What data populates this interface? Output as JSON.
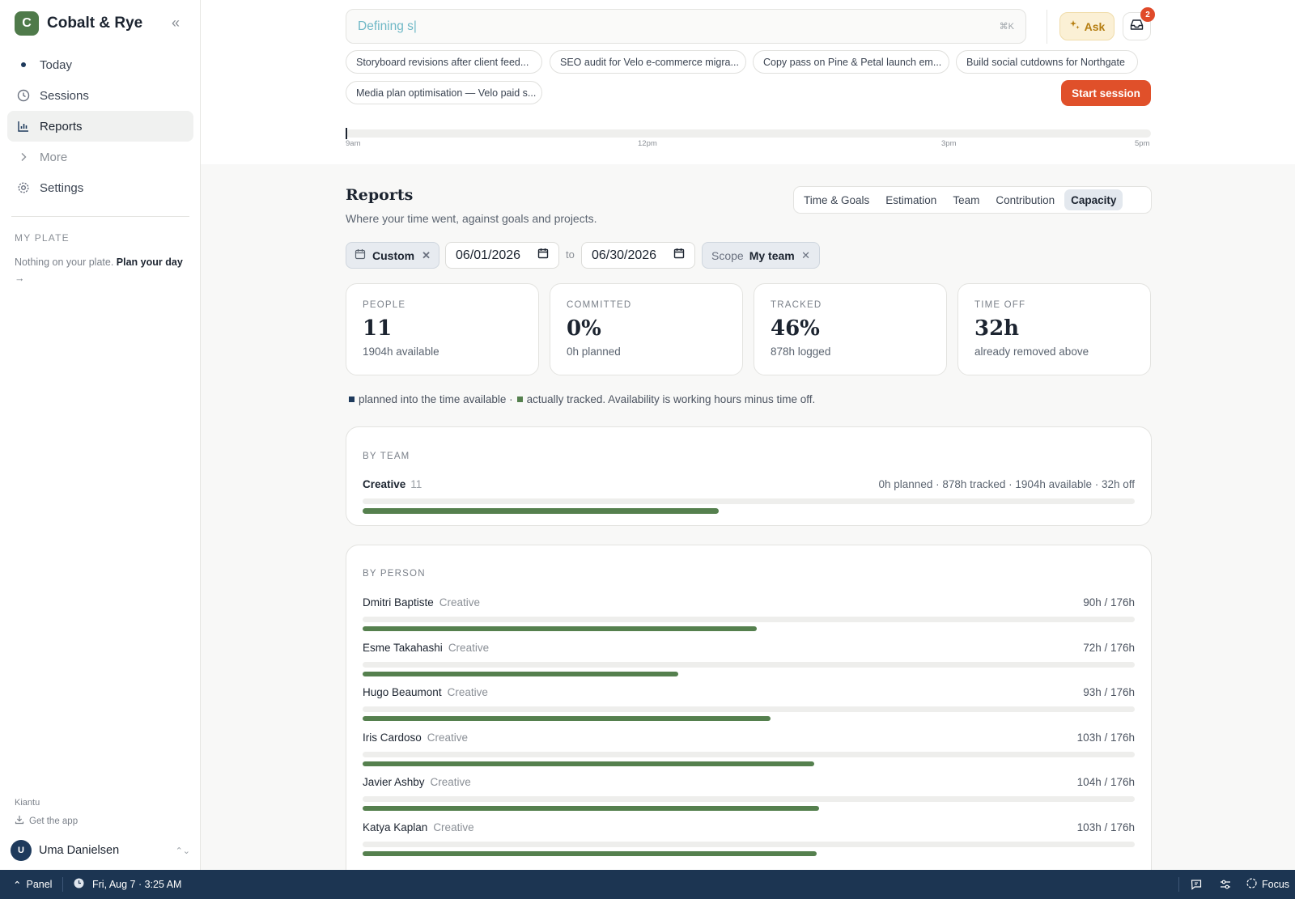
{
  "brand": {
    "initial": "C",
    "name": "Cobalt & Rye"
  },
  "nav": [
    {
      "label": "Today",
      "icon": "dot-icon",
      "active": false
    },
    {
      "label": "Sessions",
      "icon": "clock-icon",
      "active": false
    },
    {
      "label": "Reports",
      "icon": "bar-chart-icon",
      "active": true
    },
    {
      "label": "More",
      "icon": "chevron-right-icon",
      "active": false
    },
    {
      "label": "Settings",
      "icon": "gear-icon",
      "active": false
    }
  ],
  "plate": {
    "heading": "MY PLATE",
    "text": "Nothing on your plate.",
    "link": "Plan your day",
    "arrow": "→"
  },
  "footer": {
    "org": "Kiantu",
    "get_app": "Get the app",
    "user_initial": "U",
    "user_name": "Uma Danielsen"
  },
  "search": {
    "value": "Defining s|",
    "shortcut": "⌘K"
  },
  "ask_label": "Ask",
  "inbox_badge": "2",
  "suggestions": [
    "Storyboard revisions after client feed...",
    "SEO audit for Velo e-commerce migra...",
    "Copy pass on Pine & Petal launch em...",
    "Build social cutdowns for Northgate",
    "Media plan optimisation — Velo paid s..."
  ],
  "start_session": "Start session",
  "timeline": {
    "labels": [
      "9am",
      "12pm",
      "3pm",
      "5pm"
    ]
  },
  "reports": {
    "title": "Reports",
    "subtitle": "Where your time went, against goals and projects."
  },
  "tabs": [
    {
      "label": "Time & Goals",
      "active": false
    },
    {
      "label": "Estimation",
      "active": false
    },
    {
      "label": "Team",
      "active": false
    },
    {
      "label": "Contribution",
      "active": false
    },
    {
      "label": "Capacity",
      "active": true
    }
  ],
  "filters": {
    "range": "Custom",
    "from": "06/01/2026",
    "to_label": "to",
    "to": "06/30/2026",
    "scope_label": "Scope",
    "scope_value": "My team"
  },
  "stats": [
    {
      "label": "PEOPLE",
      "value": "11",
      "sub": "1904h available"
    },
    {
      "label": "COMMITTED",
      "value": "0%",
      "sub": "0h planned"
    },
    {
      "label": "TRACKED",
      "value": "46%",
      "sub": "878h logged"
    },
    {
      "label": "TIME OFF",
      "value": "32h",
      "sub": "already removed above"
    }
  ],
  "legend": {
    "planned": "planned into the time available ·",
    "tracked": "actually tracked. Availability is working hours minus time off.",
    "planned_color": "#1e3a5c",
    "tracked_color": "#55804e"
  },
  "by_team": {
    "heading": "BY TEAM",
    "teams": [
      {
        "name": "Creative",
        "count": "11",
        "summary": "0h planned · 878h tracked · 1904h available · 32h off",
        "tracked_fraction": 0.461
      }
    ]
  },
  "by_person": {
    "heading": "BY PERSON",
    "people": [
      {
        "name": "Dmitri Baptiste",
        "team": "Creative",
        "hours": "90h / 176h",
        "fraction": 0.511
      },
      {
        "name": "Esme Takahashi",
        "team": "Creative",
        "hours": "72h / 176h",
        "fraction": 0.409
      },
      {
        "name": "Hugo Beaumont",
        "team": "Creative",
        "hours": "93h / 176h",
        "fraction": 0.528
      },
      {
        "name": "Iris Cardoso",
        "team": "Creative",
        "hours": "103h / 176h",
        "fraction": 0.585
      },
      {
        "name": "Javier Ashby",
        "team": "Creative",
        "hours": "104h / 176h",
        "fraction": 0.591
      },
      {
        "name": "Katya Kaplan",
        "team": "Creative",
        "hours": "103h / 176h",
        "fraction": 0.588
      }
    ]
  },
  "taskbar": {
    "panel": "Panel",
    "datetime": "Fri, Aug 7 · 3:25 AM",
    "focus": "Focus"
  },
  "colors": {
    "accent": "#e0502a",
    "tracked": "#55804e",
    "brand": "#4f7a4a",
    "taskbar": "#1c3552"
  }
}
